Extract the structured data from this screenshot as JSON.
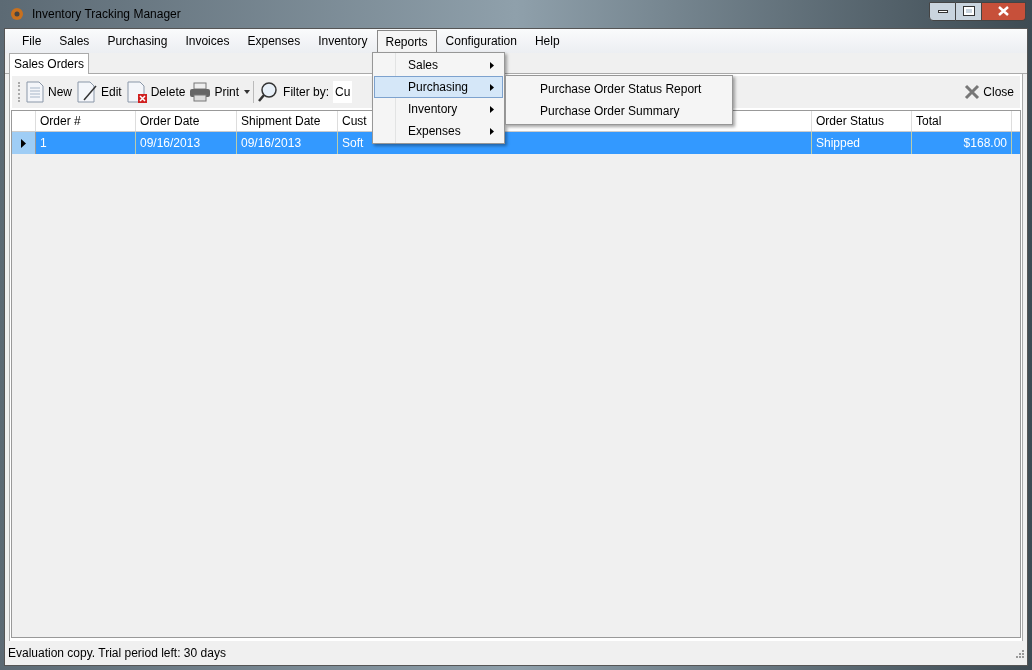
{
  "window": {
    "title": "Inventory Tracking Manager"
  },
  "menu_bar": [
    {
      "label": "File",
      "selected": false
    },
    {
      "label": "Sales",
      "selected": false
    },
    {
      "label": "Purchasing",
      "selected": false
    },
    {
      "label": "Invoices",
      "selected": false
    },
    {
      "label": "Expenses",
      "selected": false
    },
    {
      "label": "Inventory",
      "selected": false
    },
    {
      "label": "Reports",
      "selected": true
    },
    {
      "label": "Configuration",
      "selected": false
    },
    {
      "label": "Help",
      "selected": false
    }
  ],
  "reports_menu": [
    {
      "label": "Sales",
      "selected": false
    },
    {
      "label": "Purchasing",
      "selected": true
    },
    {
      "label": "Inventory",
      "selected": false
    },
    {
      "label": "Expenses",
      "selected": false
    }
  ],
  "purchasing_submenu": [
    "Purchase Order Status Report",
    "Purchase Order Summary"
  ],
  "tabs": [
    {
      "label": "Sales Orders",
      "selected": true
    }
  ],
  "toolbar": {
    "buttons": [
      {
        "kind": "new",
        "label": "New"
      },
      {
        "kind": "edit",
        "label": "Edit"
      },
      {
        "kind": "delete",
        "label": "Delete"
      },
      {
        "kind": "print",
        "label": "Print"
      }
    ],
    "filter_label": "Filter by:",
    "filter_value": "Cu",
    "close": "Close"
  },
  "table": {
    "columns": [
      "Order #",
      "Order Date",
      "Shipment Date",
      "Cust",
      "Order Status",
      "Total"
    ],
    "rows": [
      {
        "cells": [
          "1",
          "09/16/2013",
          "09/16/2013",
          "Soft",
          "Shipped",
          "$168.00"
        ],
        "selected": true
      }
    ]
  },
  "status_bar": "Evaluation copy. Trial period left: 30 days"
}
